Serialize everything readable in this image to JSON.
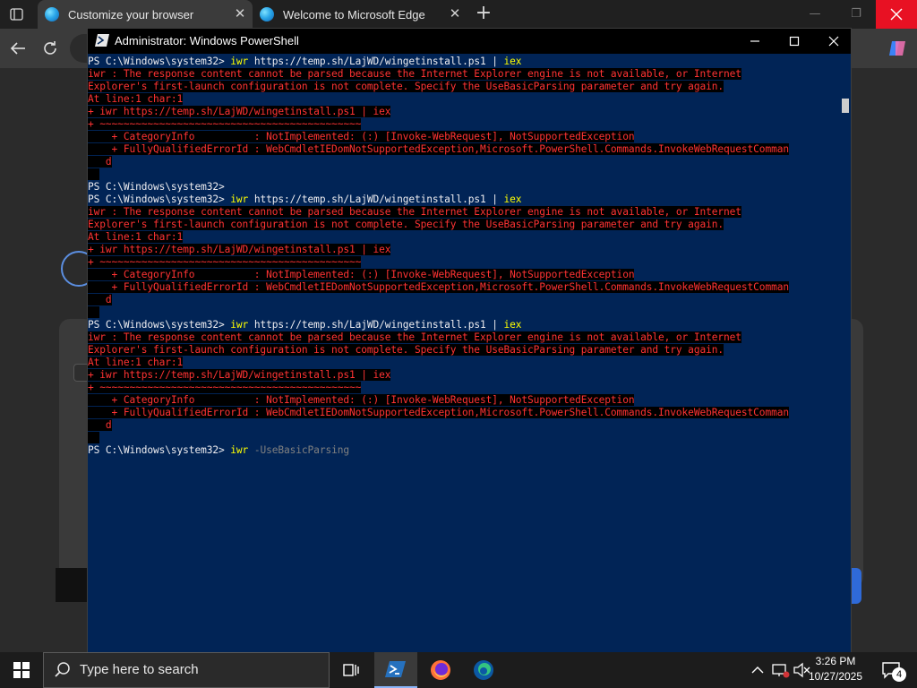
{
  "browser": {
    "tabs": [
      {
        "title": "Customize your browser",
        "active": true
      },
      {
        "title": "Welcome to Microsoft Edge",
        "active": false
      }
    ],
    "new_tab_icon": "plus-icon"
  },
  "powershell": {
    "title": "Administrator: Windows PowerShell",
    "prompt": "PS C:\\Windows\\system32> ",
    "cmd": "iwr",
    "url": " https://temp.sh/LajWD/wingetinstall.ps1 | ",
    "iex": "iex",
    "errors": {
      "e1": "iwr : The response content cannot be parsed because the Internet Explorer engine is not available, or Internet",
      "e2": "Explorer's first-launch configuration is not complete. Specify the UseBasicParsing parameter and try again.",
      "e3": "At line:1 char:1",
      "e4": "+ iwr https://temp.sh/LajWD/wingetinstall.ps1 | iex",
      "e5": "+ ~~~~~~~~~~~~~~~~~~~~~~~~~~~~~~~~~~~~~~~~~~~~",
      "e6": "    + CategoryInfo          : NotImplemented: (:) [Invoke-WebRequest], NotSupportedException",
      "e7": "    + FullyQualifiedErrorId : WebCmdletIEDomNotSupportedException,Microsoft.PowerShell.Commands.InvokeWebRequestComman",
      "e8": "   d"
    },
    "last_cmd": "iwr",
    "last_param": " -UseBasicParsing"
  },
  "taskbar": {
    "search_placeholder": "Type here to search",
    "time": "3:26 PM",
    "date": "10/27/2025",
    "notification_count": "4"
  },
  "colors": {
    "ps_background": "#012456",
    "error_text": "#ff3333",
    "command_text": "#ffff00",
    "close_red": "#e81123"
  }
}
